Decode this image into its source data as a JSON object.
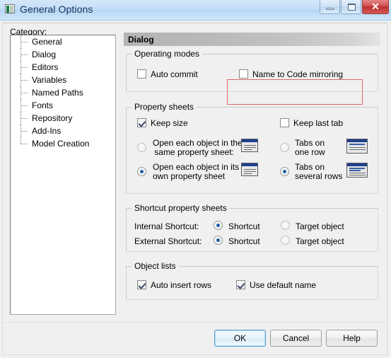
{
  "window": {
    "title": "General Options",
    "icon": "app-icon",
    "controls": {
      "minimize": "–",
      "maximize": "□",
      "close": "✕"
    }
  },
  "category": {
    "label": "Category:",
    "items": [
      {
        "label": "General"
      },
      {
        "label": "Dialog"
      },
      {
        "label": "Editors"
      },
      {
        "label": "Variables"
      },
      {
        "label": "Named Paths"
      },
      {
        "label": "Fonts"
      },
      {
        "label": "Repository"
      },
      {
        "label": "Add-Ins"
      },
      {
        "label": "Model Creation"
      }
    ]
  },
  "panel": {
    "header": "Dialog",
    "operating_modes": {
      "title": "Operating modes",
      "auto_commit": {
        "label": "Auto commit",
        "checked": false
      },
      "name_to_code": {
        "label": "Name to Code mirroring",
        "checked": false
      }
    },
    "property_sheets": {
      "title": "Property sheets",
      "keep_size": {
        "label": "Keep size",
        "checked": true
      },
      "keep_last_tab": {
        "label": "Keep last tab",
        "checked": false
      },
      "open_same_line1": "Open each object in the",
      "open_same_line2": "same property sheet:",
      "open_same_selected": false,
      "open_own_line1": "Open each object in its",
      "open_own_line2": "own property sheet",
      "open_own_selected": true,
      "tabs_one_line1": "Tabs on",
      "tabs_one_line2": "one row",
      "tabs_one_selected": false,
      "tabs_several_line1": "Tabs on",
      "tabs_several_line2": "several rows",
      "tabs_several_selected": true
    },
    "shortcut_sheets": {
      "title": "Shortcut property sheets",
      "internal_label": "Internal Shortcut:",
      "external_label": "External Shortcut:",
      "internal_shortcut": {
        "label": "Shortcut",
        "selected": true
      },
      "internal_target": {
        "label": "Target object",
        "selected": false
      },
      "external_shortcut": {
        "label": "Shortcut",
        "selected": true
      },
      "external_target": {
        "label": "Target object",
        "selected": false
      }
    },
    "object_lists": {
      "title": "Object lists",
      "auto_insert_rows": {
        "label": "Auto insert rows",
        "checked": true
      },
      "use_default_name": {
        "label": "Use default name",
        "checked": true
      }
    }
  },
  "buttons": {
    "ok": "OK",
    "cancel": "Cancel",
    "help": "Help"
  },
  "annotation": {
    "highlight_color": "#e06666"
  }
}
